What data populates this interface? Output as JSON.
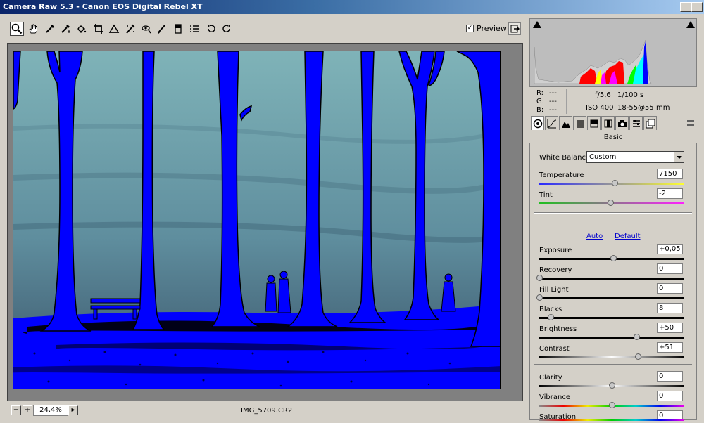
{
  "window": {
    "title": "Camera Raw 5.3  -  Canon EOS Digital Rebel XT"
  },
  "toolbar": {
    "tools": [
      {
        "icon": "zoom-icon"
      },
      {
        "icon": "hand-icon"
      },
      {
        "icon": "white-balance-icon"
      },
      {
        "icon": "color-sampler-icon"
      },
      {
        "icon": "target-adjustment-icon"
      },
      {
        "icon": "crop-icon"
      },
      {
        "icon": "straighten-icon"
      },
      {
        "icon": "spot-removal-icon"
      },
      {
        "icon": "red-eye-icon"
      },
      {
        "icon": "adjustment-brush-icon"
      },
      {
        "icon": "graduated-filter-icon"
      },
      {
        "icon": "preferences-icon"
      },
      {
        "icon": "rotate-left-icon"
      },
      {
        "icon": "rotate-right-icon"
      }
    ],
    "preview_label": "Preview",
    "preview_checked": "✓"
  },
  "status": {
    "zoom": "24,4%",
    "filename": "IMG_5709.CR2",
    "zoom_out": "−",
    "zoom_in": "+",
    "zoom_menu": "▸"
  },
  "info": {
    "r_label": "R:",
    "g_label": "G:",
    "b_label": "B:",
    "r_value": "---",
    "g_value": "---",
    "b_value": "---",
    "aperture": "f/5,6",
    "shutter": "1/100 s",
    "iso": "ISO 400",
    "lens": "18-55@55 mm"
  },
  "panel": {
    "section": "Basic",
    "white_balance_label": "White Balance:",
    "white_balance_value": "Custom",
    "auto_label": "Auto",
    "default_label": "Default",
    "sliders": {
      "temperature": {
        "label": "Temperature",
        "value": "7150",
        "fraction": 0.52
      },
      "tint": {
        "label": "Tint",
        "value": "-2",
        "fraction": 0.49
      },
      "exposure": {
        "label": "Exposure",
        "value": "+0,05",
        "fraction": 0.51
      },
      "recovery": {
        "label": "Recovery",
        "value": "0",
        "fraction": 0.0
      },
      "fill_light": {
        "label": "Fill Light",
        "value": "0",
        "fraction": 0.0
      },
      "blacks": {
        "label": "Blacks",
        "value": "8",
        "fraction": 0.08
      },
      "brightness": {
        "label": "Brightness",
        "value": "+50",
        "fraction": 0.67
      },
      "contrast": {
        "label": "Contrast",
        "value": "+51",
        "fraction": 0.68
      },
      "clarity": {
        "label": "Clarity",
        "value": "0",
        "fraction": 0.5
      },
      "vibrance": {
        "label": "Vibrance",
        "value": "0",
        "fraction": 0.5
      },
      "saturation": {
        "label": "Saturation",
        "value": "0",
        "fraction": 0.5
      }
    }
  },
  "colors": {
    "clipping_overlay": "#0000ff",
    "sky": "#6a9aa6",
    "link": "#0000cc"
  }
}
